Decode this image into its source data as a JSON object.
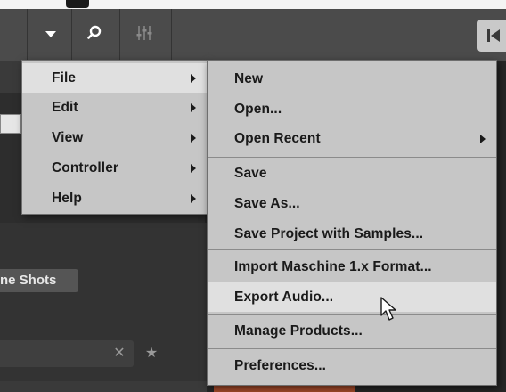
{
  "toolbar": {
    "menu_button_icon": "triangle-down-icon",
    "search_button_icon": "search-icon",
    "mixer_button_icon": "mixer-sliders-icon",
    "transport_icon": "skip-back-icon"
  },
  "main_menu": {
    "items": [
      {
        "label": "File",
        "has_submenu": true,
        "highlighted": true
      },
      {
        "label": "Edit",
        "has_submenu": true
      },
      {
        "label": "View",
        "has_submenu": true
      },
      {
        "label": "Controller",
        "has_submenu": true
      },
      {
        "label": "Help",
        "has_submenu": true
      }
    ]
  },
  "file_menu": {
    "items": [
      {
        "label": "New"
      },
      {
        "label": "Open..."
      },
      {
        "label": "Open Recent",
        "has_submenu": true
      },
      {
        "label": "Save"
      },
      {
        "label": "Save As..."
      },
      {
        "label": "Save Project with Samples..."
      },
      {
        "label": "Import Maschine 1.x Format..."
      },
      {
        "label": "Export Audio...",
        "highlighted": true
      },
      {
        "label": "Manage Products..."
      },
      {
        "label": "Preferences..."
      }
    ]
  },
  "browser": {
    "category_pill": "ne Shots",
    "clear_icon": "close-icon",
    "favorite_icon": "star-icon",
    "clear_glyph": "✕",
    "favorite_glyph": "★"
  },
  "colors": {
    "menu_bg": "#c6c6c6",
    "menu_highlight": "#e0e0e0",
    "toolbar_bg": "#4b4b4b",
    "accent_orange": "#a54a2a"
  }
}
